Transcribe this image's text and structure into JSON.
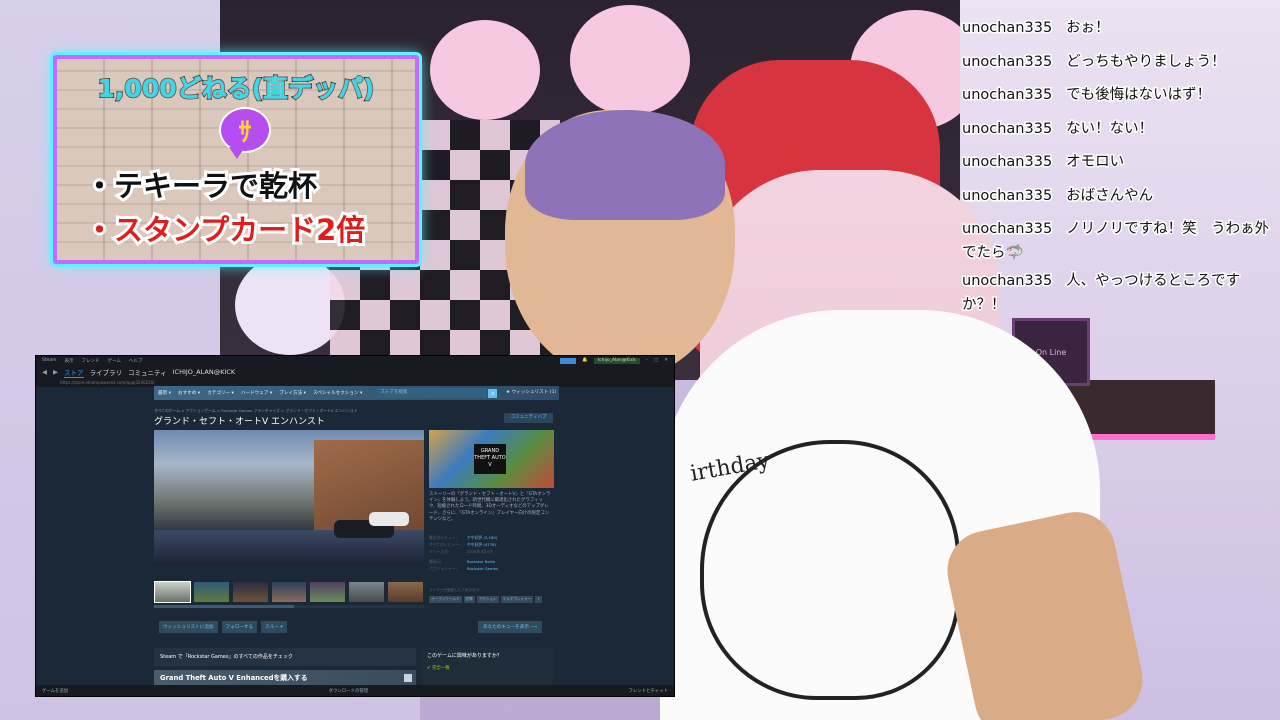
{
  "overlay_card": {
    "title": "1,000どねる(直デッパ)",
    "icon_glyph": "ｻ",
    "bullet_1": "・テキーラで乾杯",
    "bullet_2": "・スタンプカード2倍"
  },
  "chat": [
    {
      "user": "unochan335",
      "message": "おぉ！"
    },
    {
      "user": "unochan335",
      "message": "どっちもやりましょう！"
    },
    {
      "user": "unochan335",
      "message": "でも後悔はないはず！"
    },
    {
      "user": "unochan335",
      "message": "ない！ない！"
    },
    {
      "user": "unochan335",
      "message": "オモロい"
    },
    {
      "user": "unochan335",
      "message": "おばさんやん"
    },
    {
      "user": "unochan335",
      "message": "ノリノリですね！笑　うわぁ外でたら🦈"
    },
    {
      "user": "unochan335",
      "message": "人、やっつけるところですか？！"
    }
  ],
  "background": {
    "shirt_text": "irthday",
    "sign_text": "On Line"
  },
  "steam": {
    "titlebar": {
      "menu_items": [
        "Steam",
        "表示",
        "フレンド",
        "ゲーム",
        "ヘルプ"
      ],
      "user": "Ichijo_Alan@Kick"
    },
    "nav": {
      "tabs": [
        "ストア",
        "ライブラリ",
        "コミュニティ",
        "ICHIJO_ALAN@KICK"
      ]
    },
    "url": "https://store.steampowered.com/app/3240220/",
    "storebar": {
      "items": [
        "最新 ▾",
        "おすすめ ▾",
        "カテゴリー ▾",
        "ハードウェア ▾",
        "プレイ方法 ▾",
        "スペシャルセクション ▾"
      ],
      "search_placeholder": "ストアを検索",
      "wishlist": "★ ウィッシュリスト (1)"
    },
    "breadcrumb": "すべてのゲーム > アクションゲーム > Rockstar Games フランチャイズ > グランド・セフト・オートV エンハンスト",
    "game_title": "グランド・セフト・オートV エンハンスト",
    "community_hub": "コミュニティハブ",
    "capsule_logo": "GRAND THEFT AUTO V",
    "description": "ストーリーの『グランド・セフト・オートV』と『GTAオンライン』を体験しよう。新世代機に最適化されたグラフィック、短縮されたロード時間、3Dオーディオなどのアップグレード、さらに、『GTAオンライン』プレイヤー向けの限定コンテンツなど。",
    "meta": {
      "recent_reviews_label": "最近のレビュー:",
      "recent_reviews_value": "やや好評 (3,189)",
      "all_reviews_label": "すべてのレビュー:",
      "all_reviews_value": "やや好評 (4778)",
      "release_label": "リリース日:",
      "release_value": "2025年3月4日",
      "developer_label": "開発元:",
      "developer_value": "Rockstar North",
      "publisher_label": "パブリッシャー:",
      "publisher_value": "Rockstar Games"
    },
    "tags_heading": "ユーザーが登録した人気のタグ:",
    "tags": [
      "オープンワールド",
      "犯罪",
      "アクション",
      "マルチプレイヤー",
      "+"
    ],
    "actions": {
      "wishlist": "ウィッシュリストに追加",
      "follow": "フォローする",
      "ignore": "スルー ▾",
      "queue": "あなたのキューを表示 ⟶"
    },
    "rockstar_link": "Steam で「Rockstar Games」のすべての作品をチェック",
    "buy_title": "Grand Theft Auto V Enhancedを購入する",
    "interest": {
      "heading": "このゲームに興味がありますか？",
      "item": "✔ 完全一致"
    },
    "footer": {
      "left": "ゲームを追加",
      "mid": "ダウンロードの管理",
      "right": "フレンドとチャット"
    }
  }
}
